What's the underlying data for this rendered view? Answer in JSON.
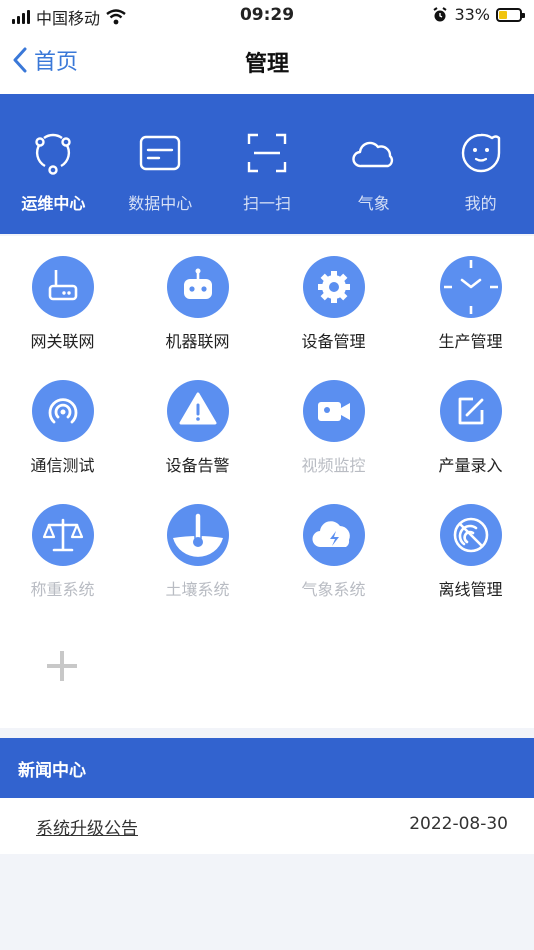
{
  "status_bar": {
    "carrier": "中国移动",
    "time": "09:29",
    "battery": "33%"
  },
  "navbar": {
    "back_label": "首页",
    "title": "管理"
  },
  "top_nav": [
    {
      "label": "运维中心",
      "icon": "ops-network-icon",
      "active": true
    },
    {
      "label": "数据中心",
      "icon": "card-icon"
    },
    {
      "label": "扫一扫",
      "icon": "scan-icon"
    },
    {
      "label": "气象",
      "icon": "cloud-icon"
    },
    {
      "label": "我的",
      "icon": "profile-face-icon"
    }
  ],
  "grid": [
    {
      "label": "网关联网",
      "icon": "router-icon",
      "enabled": true
    },
    {
      "label": "机器联网",
      "icon": "robot-icon",
      "enabled": true
    },
    {
      "label": "设备管理",
      "icon": "gear-icon",
      "enabled": true
    },
    {
      "label": "生产管理",
      "icon": "clock-icon",
      "enabled": true
    },
    {
      "label": "通信测试",
      "icon": "signal-broadcast-icon",
      "enabled": true
    },
    {
      "label": "设备告警",
      "icon": "warning-icon",
      "enabled": true
    },
    {
      "label": "视频监控",
      "icon": "video-camera-icon",
      "enabled": false
    },
    {
      "label": "产量录入",
      "icon": "edit-icon",
      "enabled": true
    },
    {
      "label": "称重系统",
      "icon": "scale-icon",
      "enabled": false
    },
    {
      "label": "土壤系统",
      "icon": "thermometer-icon",
      "enabled": false
    },
    {
      "label": "气象系统",
      "icon": "cloud-lightning-icon",
      "enabled": false
    },
    {
      "label": "离线管理",
      "icon": "offline-icon",
      "enabled": true
    }
  ],
  "news": {
    "title": "新闻中心",
    "items": [
      {
        "title": "系统升级公告",
        "date": "2022-08-30"
      }
    ]
  },
  "colors": {
    "primary": "#3263cf",
    "icon_circle": "#5b8ff0",
    "link": "#3a78d8",
    "disabled_text": "#b9bcc3"
  }
}
